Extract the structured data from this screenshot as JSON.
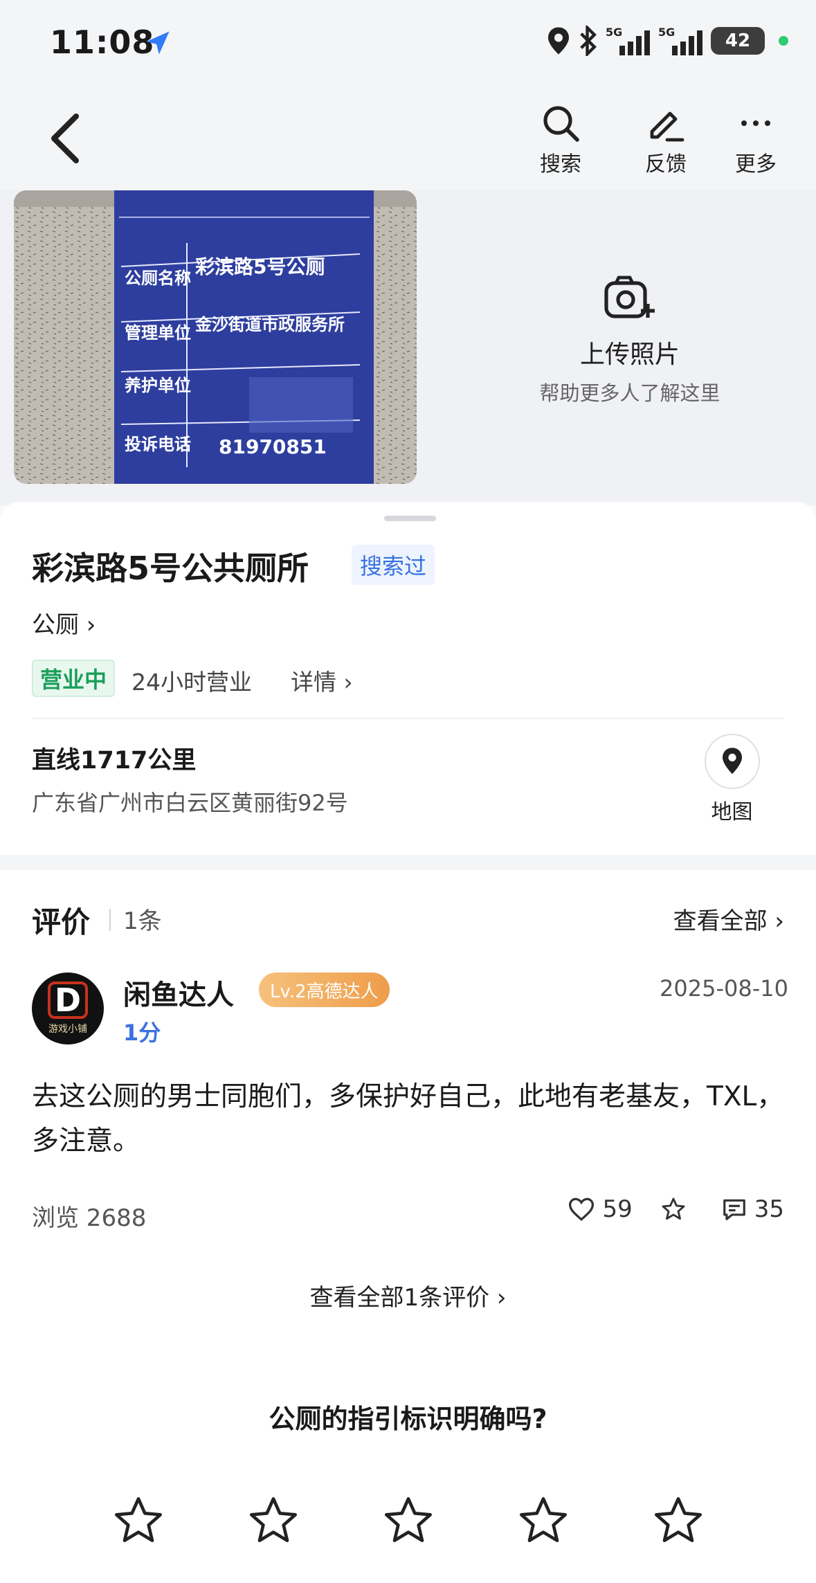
{
  "status": {
    "time": "11:08",
    "battery": "42",
    "network": "5G"
  },
  "nav": {
    "search_label": "搜索",
    "feedback_label": "反馈",
    "more_label": "更多"
  },
  "photo": {
    "sign_rows": [
      {
        "key": "公厕名称",
        "value": "彩滨路5号公厕"
      },
      {
        "key": "管理单位",
        "value": "金沙街道市政服务所"
      },
      {
        "key": "养护单位",
        "value": ""
      },
      {
        "key": "投诉电话",
        "value": "81970851"
      }
    ],
    "upload_title": "上传照片",
    "upload_sub": "帮助更多人了解这里"
  },
  "place": {
    "title": "彩滨路5号公共厕所",
    "searched_tag": "搜索过",
    "category": "公厕 ›",
    "open_status": "营业中",
    "hours": "24小时营业",
    "hours_detail": "详情 ›",
    "distance": "直线1717公里",
    "address": "广东省广州市白云区黄丽街92号",
    "map_label": "地图"
  },
  "reviews": {
    "title": "评价",
    "count": "1条",
    "see_all": "查看全部 ›",
    "items": [
      {
        "user": "闲鱼达人",
        "level_badge": "Lv.2高德达人",
        "date": "2025-08-10",
        "score": "1分",
        "avatar_letter": "D",
        "avatar_caption": "游戏小铺",
        "text": "去这公厕的男士同胞们，多保护好自己，此地有老基友，TXL，多注意。",
        "views": "浏览 2688",
        "likes": "59",
        "comments": "35"
      }
    ],
    "see_all_reviews": "查看全部1条评价 ›",
    "question": "公厕的指引标识明确吗?"
  },
  "colors": {
    "accent_blue": "#3b72e0",
    "open_green": "#1a9e5a",
    "badge_orange": "#ee9d4a"
  }
}
